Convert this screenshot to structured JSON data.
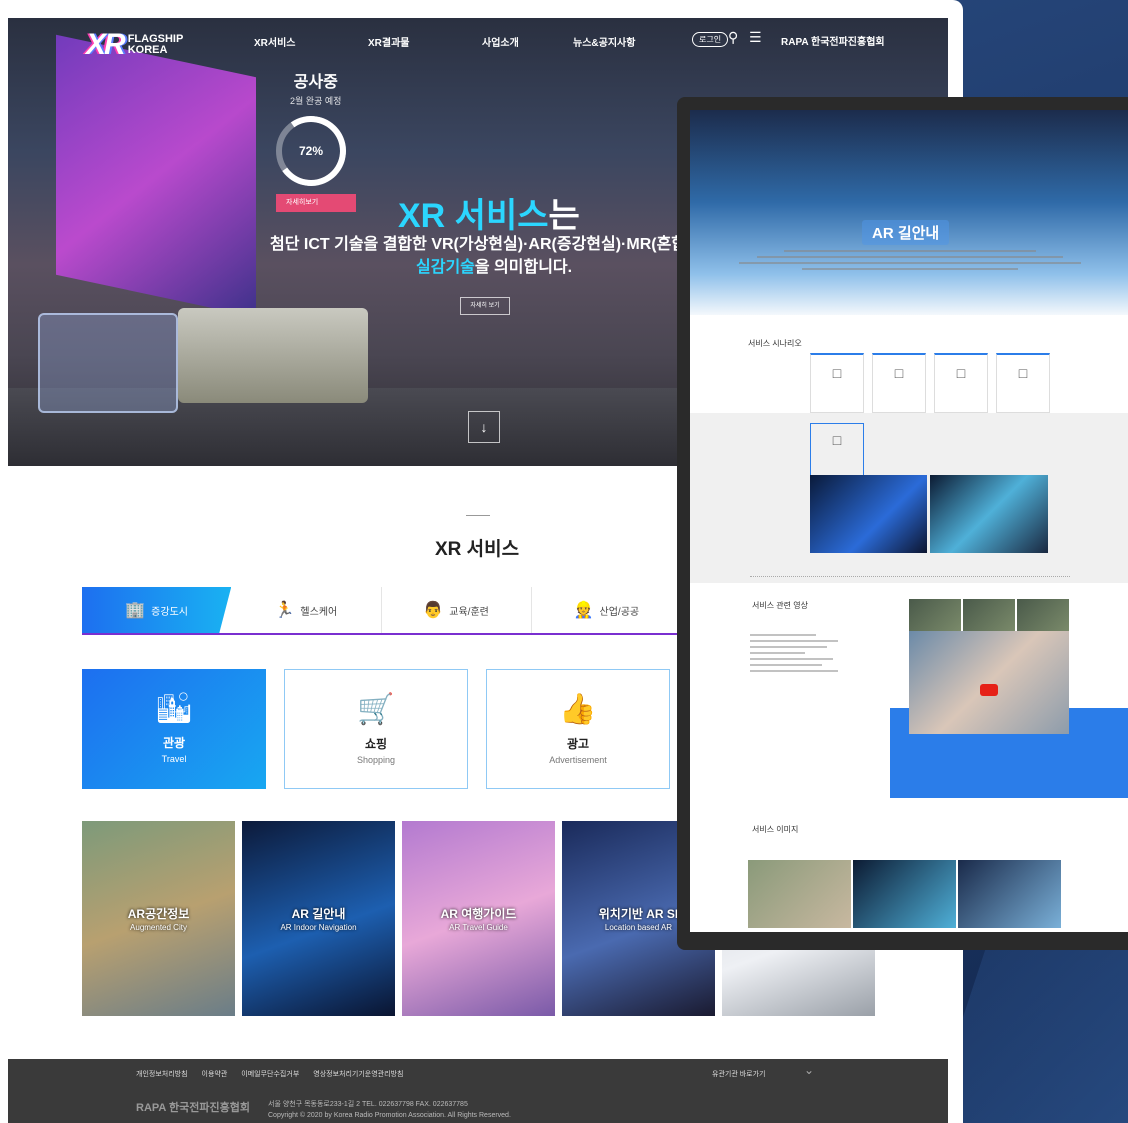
{
  "header": {
    "logo_mark": "XR",
    "logo_text1": "FLAGSHIP",
    "logo_text2": "KOREA",
    "nav": [
      "XR서비스",
      "XR결과물",
      "사업소개",
      "뉴스&공지사항"
    ],
    "login": "로그인",
    "org": "RAPA 한국전파진흥협회"
  },
  "hero": {
    "status_title": "공사중",
    "status_sub": "2월 완공 예정",
    "progress_pct": 72,
    "progress_label": "72%",
    "pink_button": "자세히보기",
    "headline_main": "XR 서비스",
    "headline_suffix": "는",
    "line1": "첨단 ICT 기술을 결합한 VR(가상현실)·AR(증강현실)·MR(혼합현실) 등",
    "line2_blue": "실감기술",
    "line2_rest": "을 의미합니다.",
    "detail_button": "자세히 보기",
    "scroll_icon": "chevron-double-down"
  },
  "xr_section": {
    "title": "XR 서비스",
    "tabs": [
      {
        "label": "증강도시",
        "icon": "building-icon"
      },
      {
        "label": "헬스케어",
        "icon": "runner-icon"
      },
      {
        "label": "교육/훈련",
        "icon": "teacher-icon"
      },
      {
        "label": "산업/공공",
        "icon": "worker-icon"
      }
    ],
    "cards": [
      {
        "name": "관광",
        "en": "Travel",
        "icon": "city-icon"
      },
      {
        "name": "쇼핑",
        "en": "Shopping",
        "icon": "cart-icon"
      },
      {
        "name": "광고",
        "en": "Advertisement",
        "icon": "thumbs-up-icon"
      }
    ],
    "photos": [
      {
        "title": "AR공간정보",
        "en": "Augmented City"
      },
      {
        "title": "AR 길안내",
        "en": "AR Indoor Navigation"
      },
      {
        "title": "AR 여행가이드",
        "en": "AR Travel Guide"
      },
      {
        "title": "위치기반 AR SI",
        "en": "Location based AR"
      }
    ]
  },
  "footer": {
    "links": [
      "개인정보처리방침",
      "이용약관",
      "이메일무단수집거부",
      "영상정보처리기기운영관리방침"
    ],
    "related": "유관기관 바로가기",
    "org": "RAPA 한국전파진흥협회",
    "address": "서울 양천구 목동동로233-1길 2  TEL. 022637798  FAX. 022637785",
    "copyright": "Copyright © 2020 by Korea Radio Promotion Association. All Rights Reserved."
  },
  "overlay": {
    "title": "AR 길안내",
    "section1": "서비스 시나리오",
    "section2": "서비스 관련 영상",
    "section3": "서비스 이미지"
  }
}
